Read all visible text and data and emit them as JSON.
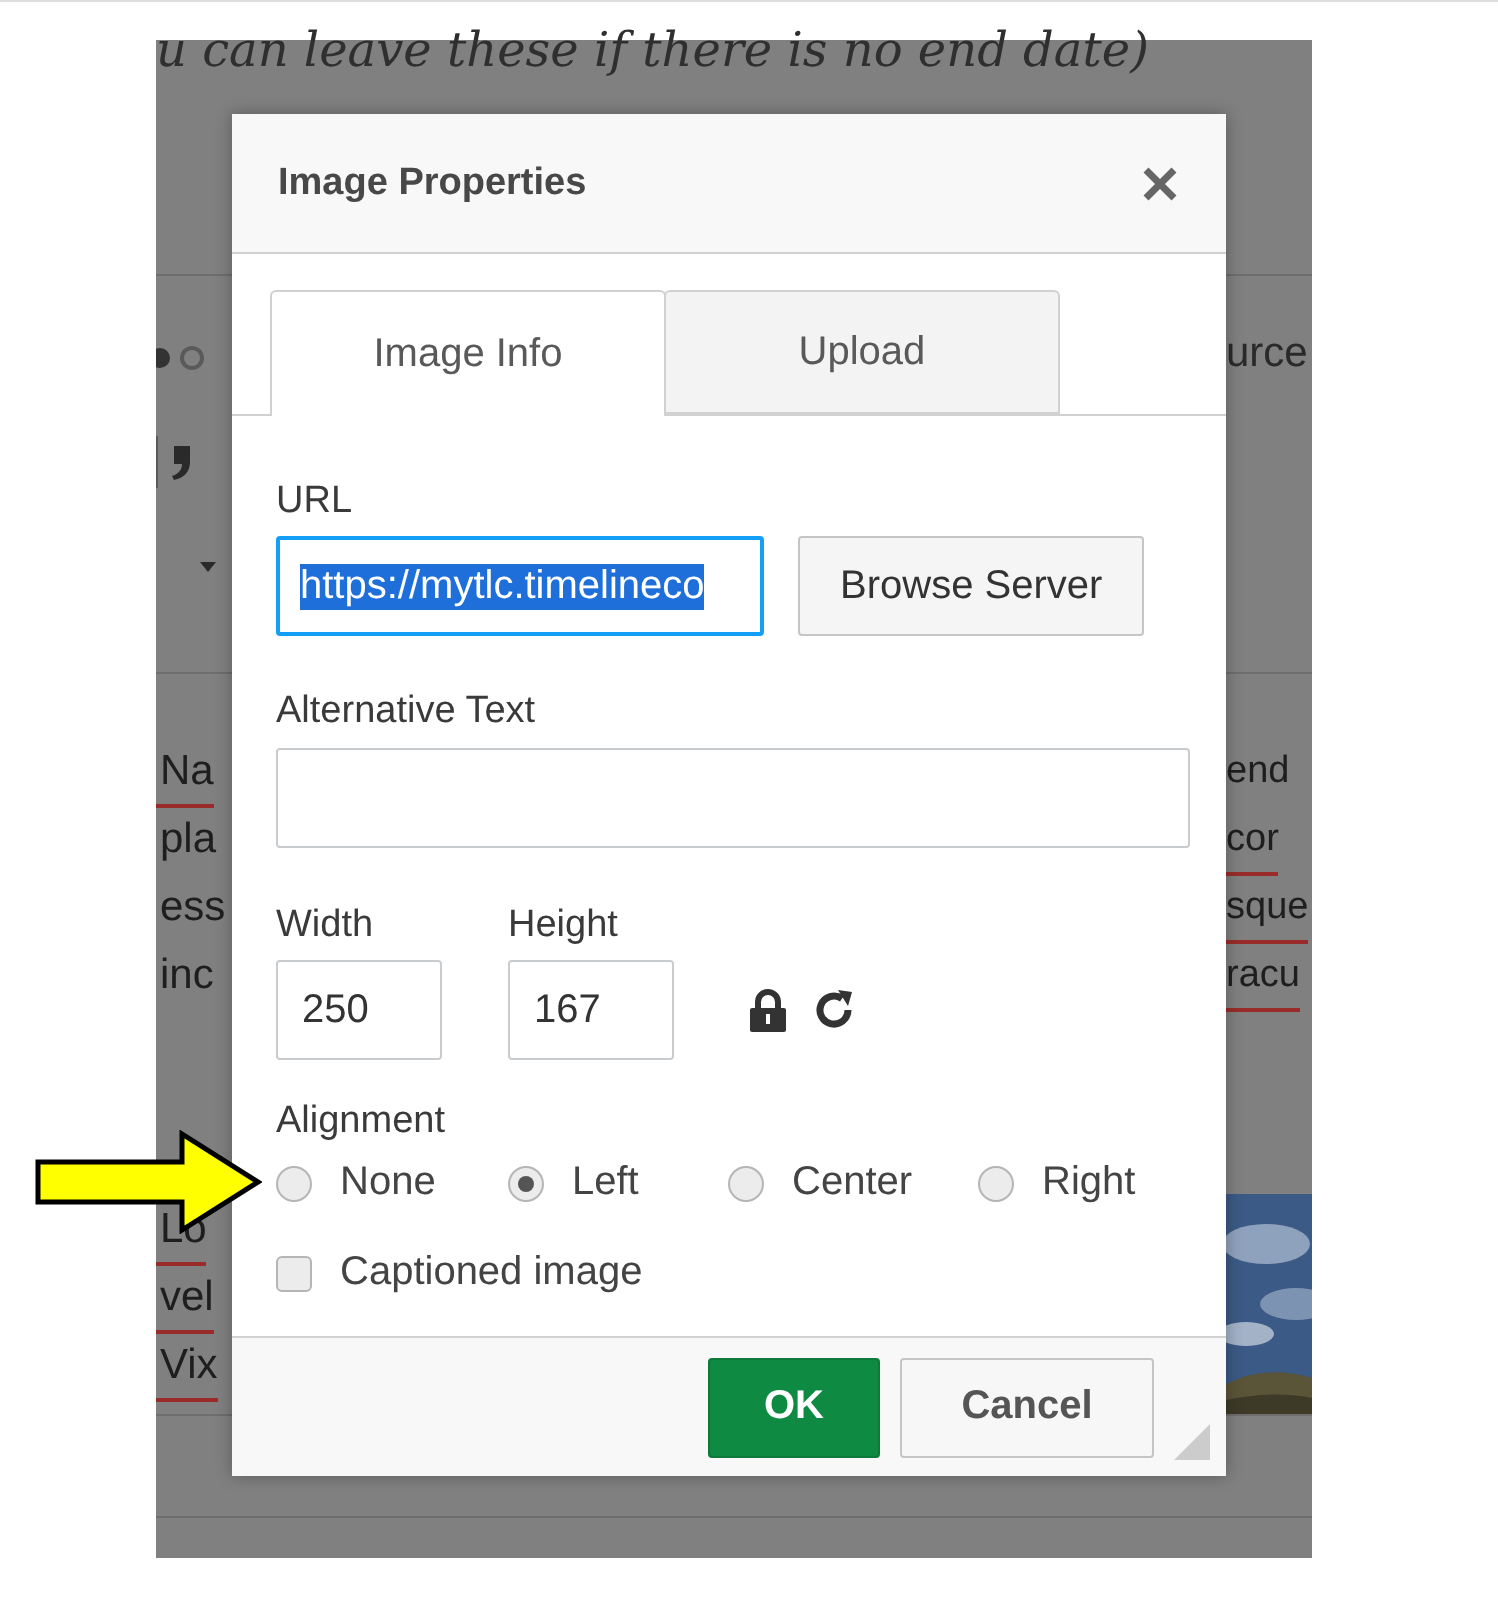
{
  "background": {
    "note": "u can leave these if there is no end date)",
    "toolbar_text": "urce",
    "left_text": [
      {
        "text": "Na",
        "misspelled": true
      },
      {
        "text": "pla",
        "misspelled": false
      },
      {
        "text": "ess",
        "misspelled": false
      },
      {
        "text": "inc",
        "misspelled": false
      }
    ],
    "right_text": [
      {
        "text": "end",
        "misspelled": false
      },
      {
        "text": "cor",
        "misspelled": true
      },
      {
        "text": "sque",
        "misspelled": true
      },
      {
        "text": "racu",
        "misspelled": true
      }
    ],
    "lower_left_text": [
      {
        "text": "Lo",
        "misspelled": true
      },
      {
        "text": "vel",
        "misspelled": true
      },
      {
        "text": "Vix",
        "misspelled": true
      }
    ]
  },
  "dialog": {
    "title": "Image Properties",
    "tabs": [
      {
        "label": "Image Info",
        "selected": true
      },
      {
        "label": "Upload",
        "selected": false
      }
    ],
    "url": {
      "label": "URL",
      "value": "https://mytlc.timelineco"
    },
    "browse_button": "Browse Server",
    "alt_text": {
      "label": "Alternative Text"
    },
    "width": {
      "label": "Width",
      "value": "250"
    },
    "height": {
      "label": "Height",
      "value": "167"
    },
    "alignment": {
      "label": "Alignment",
      "options": [
        {
          "label": "None",
          "selected": false
        },
        {
          "label": "Left",
          "selected": true
        },
        {
          "label": "Center",
          "selected": false
        },
        {
          "label": "Right",
          "selected": false
        }
      ]
    },
    "captioned": {
      "label": "Captioned image",
      "checked": false
    },
    "buttons": [
      {
        "label": "OK",
        "kind": "primary"
      },
      {
        "label": "Cancel",
        "kind": "secondary"
      }
    ]
  }
}
